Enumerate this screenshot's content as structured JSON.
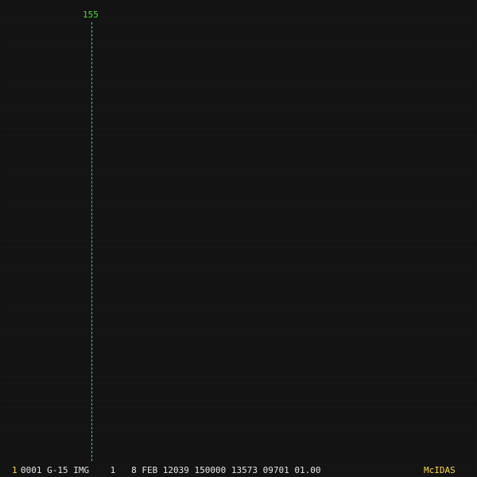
{
  "overlay": {
    "grid_label": "155"
  },
  "status_bar": {
    "frame_number": "1",
    "image_info": "0001 G-15 IMG    1   8 FEB 12039 150000 13573 09701 01.00",
    "app_name": "McIDAS"
  },
  "colors": {
    "background": "#131313",
    "grid_line": "#4ac3d6",
    "grid_label": "#4fdc3a",
    "status_text": "#e6e6e6",
    "status_highlight": "#ffd84a"
  }
}
